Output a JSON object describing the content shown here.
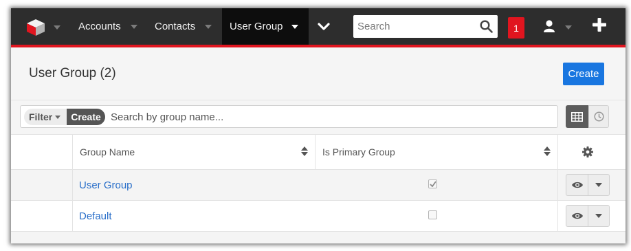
{
  "nav": {
    "accounts": "Accounts",
    "contacts": "Contacts",
    "active_tab": "User Group",
    "search_placeholder": "Search",
    "notification_count": "1"
  },
  "header": {
    "title": "User Group (2)",
    "create_label": "Create"
  },
  "filter": {
    "filter_label": "Filter",
    "create_label": "Create",
    "search_placeholder": "Search by group name..."
  },
  "table": {
    "columns": [
      "Group Name",
      "Is Primary Group"
    ],
    "rows": [
      {
        "name": "User Group",
        "is_primary": true
      },
      {
        "name": "Default",
        "is_primary": false
      }
    ]
  },
  "icons": {
    "logo": "cube-logo-icon",
    "more": "chevron-down-icon",
    "search": "search-icon",
    "user": "user-icon",
    "add": "plus-icon",
    "grid": "grid-view-icon",
    "history": "clock-icon",
    "settings": "gear-icon",
    "view": "eye-icon",
    "sort": "sort-icon"
  },
  "colors": {
    "navbar": "#2d2d2d",
    "accent_red": "#e1151f",
    "primary_button": "#1976e0",
    "link": "#2a6fc9"
  }
}
